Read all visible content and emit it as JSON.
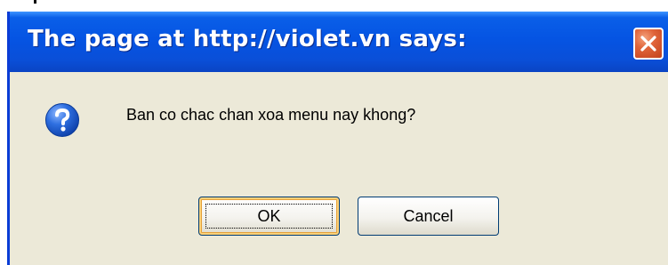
{
  "dialog": {
    "title": "The page at http://violet.vn says:",
    "message": "Ban co chac chan xoa menu nay khong?",
    "icon": "question-icon",
    "close_icon": "close-icon",
    "buttons": {
      "ok_label": "OK",
      "cancel_label": "Cancel"
    }
  },
  "colors": {
    "titlebar": "#0554e3",
    "body": "#ece9d8",
    "close": "#e0643a",
    "question_icon": "#1c58c8"
  }
}
